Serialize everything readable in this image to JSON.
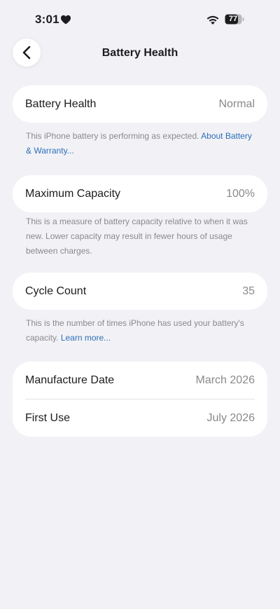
{
  "status_bar": {
    "time": "3:01",
    "battery_level": "77"
  },
  "nav": {
    "title": "Battery Health"
  },
  "battery_health": {
    "label": "Battery Health",
    "value": "Normal",
    "footnote": "This iPhone battery is performing as expected. ",
    "footnote_link": "About Battery & Warranty..."
  },
  "maximum_capacity": {
    "label": "Maximum Capacity",
    "value": "100%",
    "footnote": "This is a measure of battery capacity relative to when it was new. Lower capacity may result in fewer hours of usage between charges."
  },
  "cycle_count": {
    "label": "Cycle Count",
    "value": "35",
    "footnote": "This is the number of times iPhone has used your battery's capacity. ",
    "footnote_link": "Learn more..."
  },
  "dates": {
    "manufacture_label": "Manufacture Date",
    "manufacture_value": "March 2026",
    "first_use_label": "First Use",
    "first_use_value": "July 2026"
  },
  "colors": {
    "background": "#f2f2f6",
    "link": "#2d6fb7",
    "secondary_text": "#8a8a8e"
  }
}
